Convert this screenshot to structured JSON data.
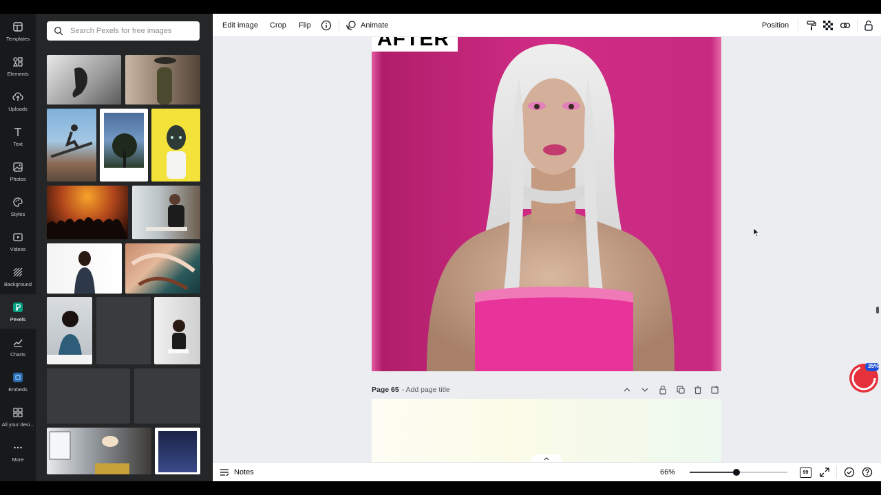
{
  "rail": {
    "items": [
      {
        "label": "Templates",
        "icon": "templates-icon"
      },
      {
        "label": "Elements",
        "icon": "elements-icon"
      },
      {
        "label": "Uploads",
        "icon": "uploads-icon"
      },
      {
        "label": "Text",
        "icon": "text-icon"
      },
      {
        "label": "Photos",
        "icon": "photos-icon"
      },
      {
        "label": "Styles",
        "icon": "styles-icon"
      },
      {
        "label": "Videos",
        "icon": "videos-icon"
      },
      {
        "label": "Background",
        "icon": "background-icon"
      },
      {
        "label": "Pexels",
        "icon": "pexels-icon"
      },
      {
        "label": "Charts",
        "icon": "charts-icon"
      },
      {
        "label": "Embeds",
        "icon": "embeds-icon"
      },
      {
        "label": "All your desi...",
        "icon": "all-designs-icon"
      },
      {
        "label": "More",
        "icon": "more-icon"
      }
    ],
    "active": "Pexels"
  },
  "panel": {
    "search_placeholder": "Search Pexels for free images"
  },
  "toolbar": {
    "edit_image": "Edit image",
    "crop": "Crop",
    "flip": "Flip",
    "animate": "Animate",
    "position": "Position"
  },
  "canvas": {
    "overlay_text": "AFTER",
    "page_label": "Page 65",
    "page_title_placeholder": "- Add page title"
  },
  "badge": {
    "text": "35%"
  },
  "footer": {
    "notes": "Notes",
    "zoom": "66%",
    "zoom_level": 0.48,
    "page_count": "99"
  },
  "colors": {
    "rail_bg": "#18191b",
    "panel_bg": "#252627",
    "canvas_bg": "#ebedf0",
    "accent_pink": "#e0308f",
    "pexels_green": "#05a081"
  }
}
